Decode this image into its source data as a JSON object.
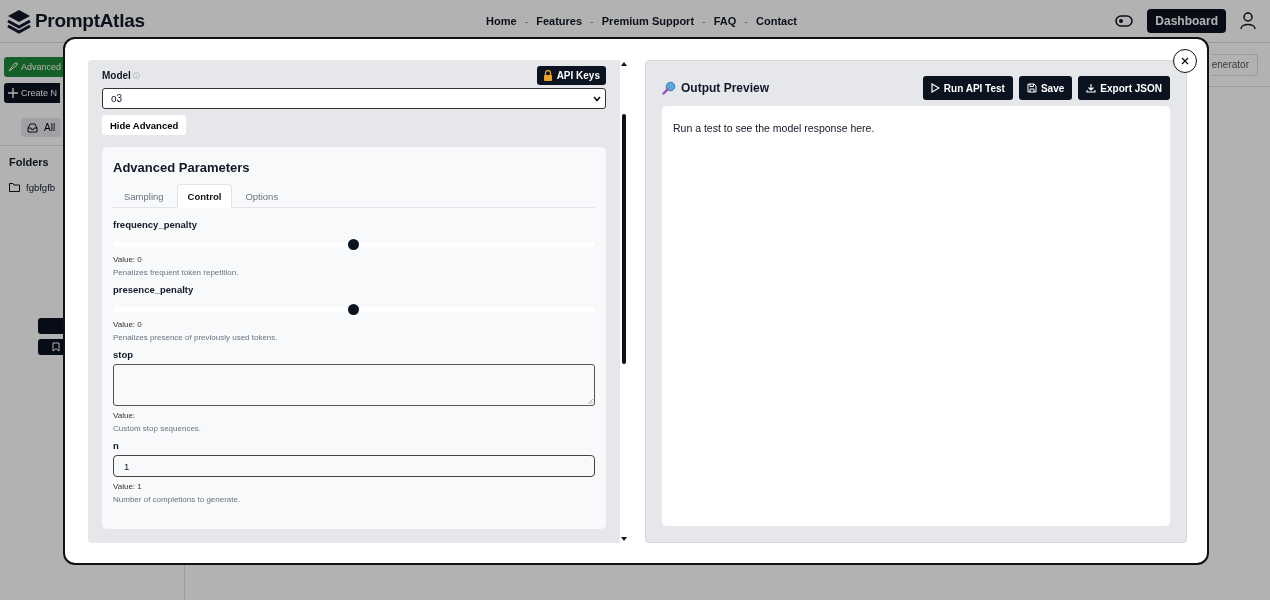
{
  "header": {
    "logo": "PromptAtlas",
    "nav": [
      {
        "kind": "link",
        "label": "Home"
      },
      {
        "kind": "separator",
        "label": "-"
      },
      {
        "kind": "link",
        "label": "Features"
      },
      {
        "kind": "separator",
        "label": "-"
      },
      {
        "kind": "link",
        "label": "Premium Support"
      },
      {
        "kind": "separator",
        "label": "-"
      },
      {
        "kind": "link",
        "label": "FAQ"
      },
      {
        "kind": "separator",
        "label": "-"
      },
      {
        "kind": "link",
        "label": "Contact"
      }
    ],
    "dashboard_button": "Dashboard"
  },
  "sidebar": {
    "buttons": [
      {
        "kind": "primary",
        "label": "Advanced"
      },
      {
        "kind": "dark",
        "label": "Create N"
      }
    ],
    "filter": "All",
    "folders_title": "Folders",
    "folders": [
      "fgbfgfb"
    ]
  },
  "background_button": "enerator",
  "modal": {
    "model_label": "Model",
    "api_keys_button": "API Keys",
    "model_select": "o3",
    "hide_advanced_button": "Hide Advanced",
    "advanced": {
      "title": "Advanced Parameters",
      "tabs": [
        {
          "label": "Sampling",
          "selected": false
        },
        {
          "label": "Control",
          "selected": true
        },
        {
          "label": "Options",
          "selected": false
        }
      ],
      "params": [
        {
          "kind": "slider",
          "name": "frequency_penalty",
          "level": 0.5,
          "value": "Value: 0",
          "description": "Penalizes frequent token repetition."
        },
        {
          "kind": "slider",
          "name": "presence_penalty",
          "level": 0.5,
          "value": "Value: 0",
          "description": "Penalizes presence of previously used tokens."
        },
        {
          "kind": "textarea",
          "name": "stop",
          "value": "Value:",
          "description": "Custom stop sequences."
        },
        {
          "kind": "number",
          "name": "n",
          "input": "1",
          "value": "Value: 1",
          "description": "Number of completions to generate."
        }
      ]
    },
    "output": {
      "title": "Output Preview",
      "buttons": [
        {
          "kind": "run",
          "label": "Run API Test"
        },
        {
          "kind": "save",
          "label": "Save"
        },
        {
          "kind": "export",
          "label": "Export JSON"
        }
      ],
      "placeholder": "Run a test to see the model response here."
    }
  }
}
